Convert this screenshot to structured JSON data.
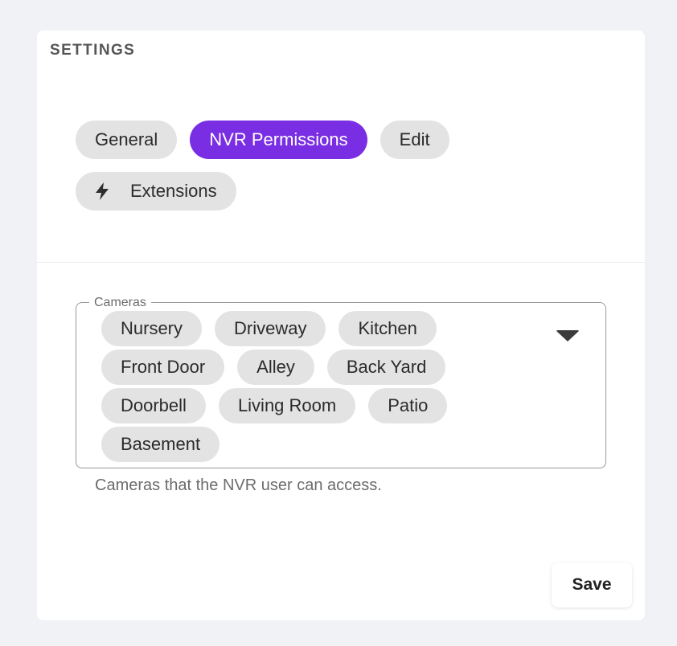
{
  "settings": {
    "title": "SETTINGS"
  },
  "tabs": [
    {
      "label": "General",
      "active": false
    },
    {
      "label": "NVR Permissions",
      "active": true
    },
    {
      "label": "Edit",
      "active": false
    },
    {
      "label": "Extensions",
      "active": false,
      "icon": "bolt-icon"
    }
  ],
  "cameras": {
    "legend": "Cameras",
    "selected": [
      "Nursery",
      "Driveway",
      "Kitchen",
      "Front Door",
      "Alley",
      "Back Yard",
      "Doorbell",
      "Living Room",
      "Patio",
      "Basement"
    ],
    "dropdown_icon": "caret-down-icon",
    "helper_text": "Cameras that the NVR user can access."
  },
  "actions": {
    "save_label": "Save"
  },
  "colors": {
    "accent": "#7a2ee4",
    "chip_bg": "#e3e3e3",
    "page_bg": "#f1f2f5"
  }
}
